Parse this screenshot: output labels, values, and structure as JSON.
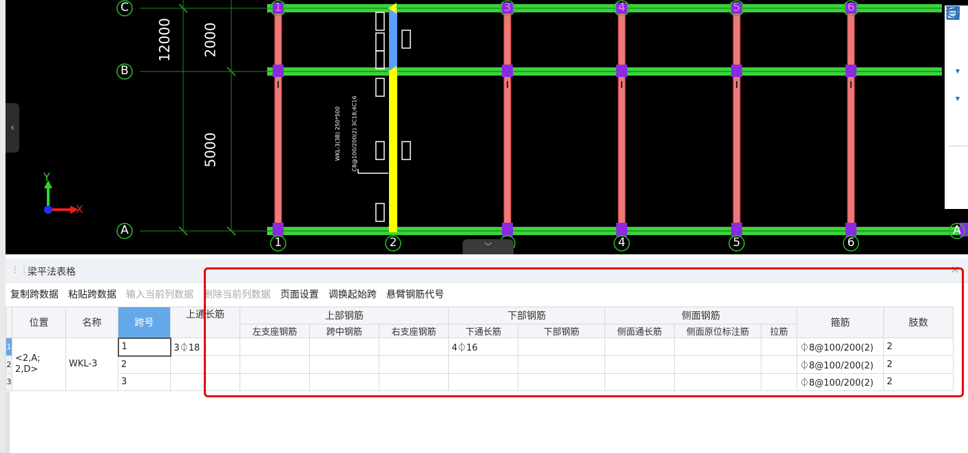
{
  "cad": {
    "grid_rows": [
      "C",
      "B",
      "A",
      "A"
    ],
    "grid_cols_top": [
      "1",
      "3",
      "4",
      "5",
      "6"
    ],
    "grid_cols_bottom": [
      "1",
      "2",
      "4",
      "5",
      "6"
    ],
    "dimensions": [
      "12000",
      "2000",
      "5000"
    ],
    "axis_y": "Y",
    "axis_x": "X",
    "beam_annotation_1": "WKL-3(3B) 250*500",
    "beam_annotation_2": "C8@100/200(2) 3C18;4C16"
  },
  "right_toolbar": {
    "items": [
      "orbit-icon",
      "3d-view-icon",
      "cube-icon",
      "cube-solid-icon",
      "fullscreen-icon",
      "view-box-icon",
      "property-icon"
    ],
    "label_3d": "3D"
  },
  "panel": {
    "title": "梁平法表格",
    "close": "×",
    "actions": [
      {
        "label": "复制跨数据",
        "enabled": true
      },
      {
        "label": "粘贴跨数据",
        "enabled": true
      },
      {
        "label": "输入当前列数据",
        "enabled": false
      },
      {
        "label": "删除当前列数据",
        "enabled": false
      },
      {
        "label": "页面设置",
        "enabled": true
      },
      {
        "label": "调换起始跨",
        "enabled": true
      },
      {
        "label": "悬臂钢筋代号",
        "enabled": true
      }
    ],
    "headers": {
      "position": "位置",
      "name": "名称",
      "span_no": "跨号",
      "top_long": "上通长筋",
      "upper_group": "上部钢筋",
      "upper_left": "左支座钢筋",
      "upper_mid": "跨中钢筋",
      "upper_right": "右支座钢筋",
      "lower_group": "下部钢筋",
      "lower_long": "下通长筋",
      "lower_bar": "下部钢筋",
      "side_group": "侧面钢筋",
      "side_long": "侧面通长筋",
      "side_orig": "侧面原位标注筋",
      "tie": "拉筋",
      "stirrup": "箍筋",
      "legs": "肢数"
    },
    "rows": [
      {
        "idx": "1",
        "span": "1",
        "top_long": "3⏀18",
        "lower_long": "4⏀16",
        "stirrup": "⏀8@100/200(2)",
        "legs": "2"
      },
      {
        "idx": "2",
        "span": "2",
        "top_long": "",
        "lower_long": "",
        "stirrup": "⏀8@100/200(2)",
        "legs": "2"
      },
      {
        "idx": "3",
        "span": "3",
        "top_long": "",
        "lower_long": "",
        "stirrup": "⏀8@100/200(2)",
        "legs": "2"
      }
    ],
    "merged_position": "<2,A;\n2,D>",
    "merged_name": "WKL-3"
  }
}
